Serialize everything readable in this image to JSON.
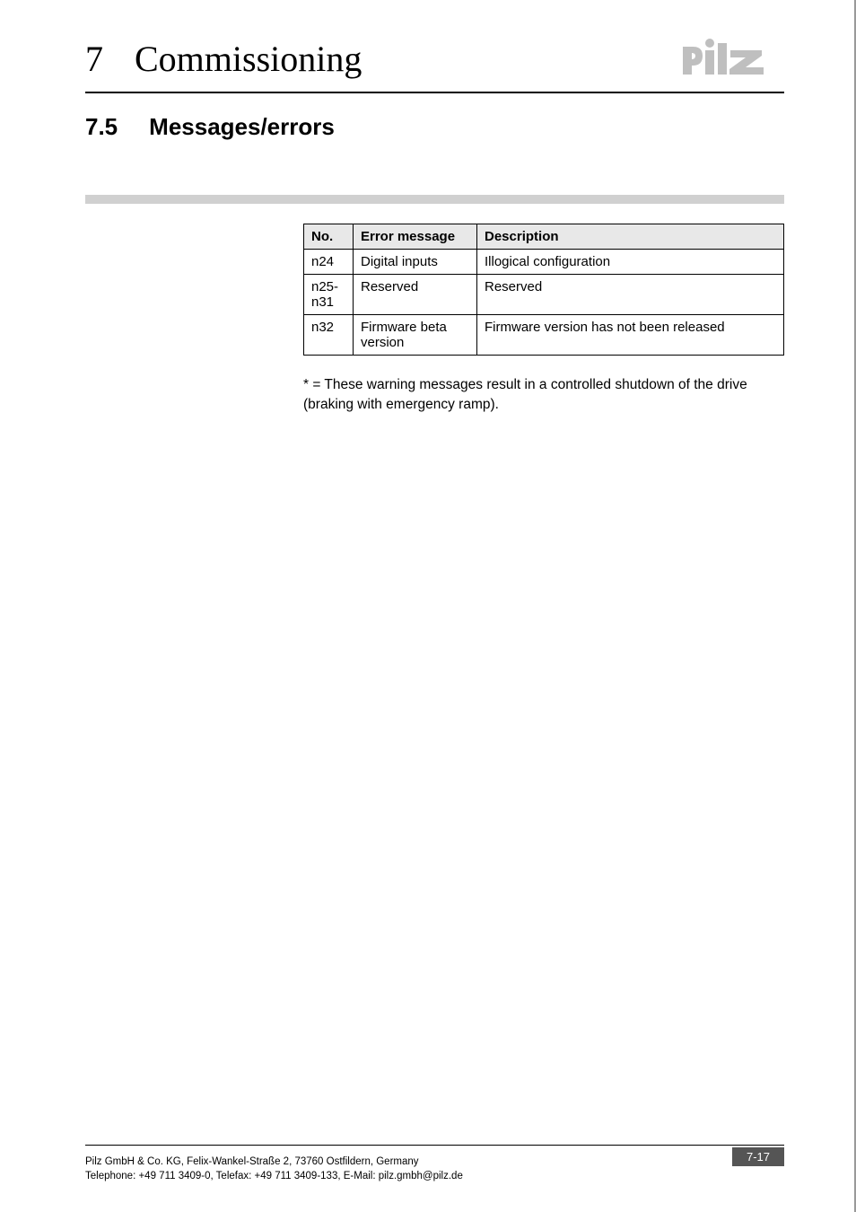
{
  "header": {
    "chapter_num": "7",
    "chapter_title": "Commissioning"
  },
  "section": {
    "num": "7.5",
    "title": "Messages/errors"
  },
  "table": {
    "headers": {
      "no": "No.",
      "msg": "Error message",
      "desc": "Description"
    },
    "rows": [
      {
        "no": "n24",
        "msg": "Digital inputs",
        "desc": "Illogical configuration"
      },
      {
        "no": "n25-n31",
        "msg": "Reserved",
        "desc": "Reserved"
      },
      {
        "no": "n32",
        "msg": "Firmware beta version",
        "desc": "Firmware version has not been released"
      }
    ]
  },
  "footnote": "* = These warning messages result in a controlled shutdown of the drive (braking with emergency ramp).",
  "footer": {
    "line1": "Pilz GmbH & Co. KG, Felix-Wankel-Straße 2, 73760 Ostfildern, Germany",
    "line2": "Telephone: +49 711 3409-0, Telefax: +49 711 3409-133, E-Mail: pilz.gmbh@pilz.de",
    "page_num": "7-17"
  }
}
